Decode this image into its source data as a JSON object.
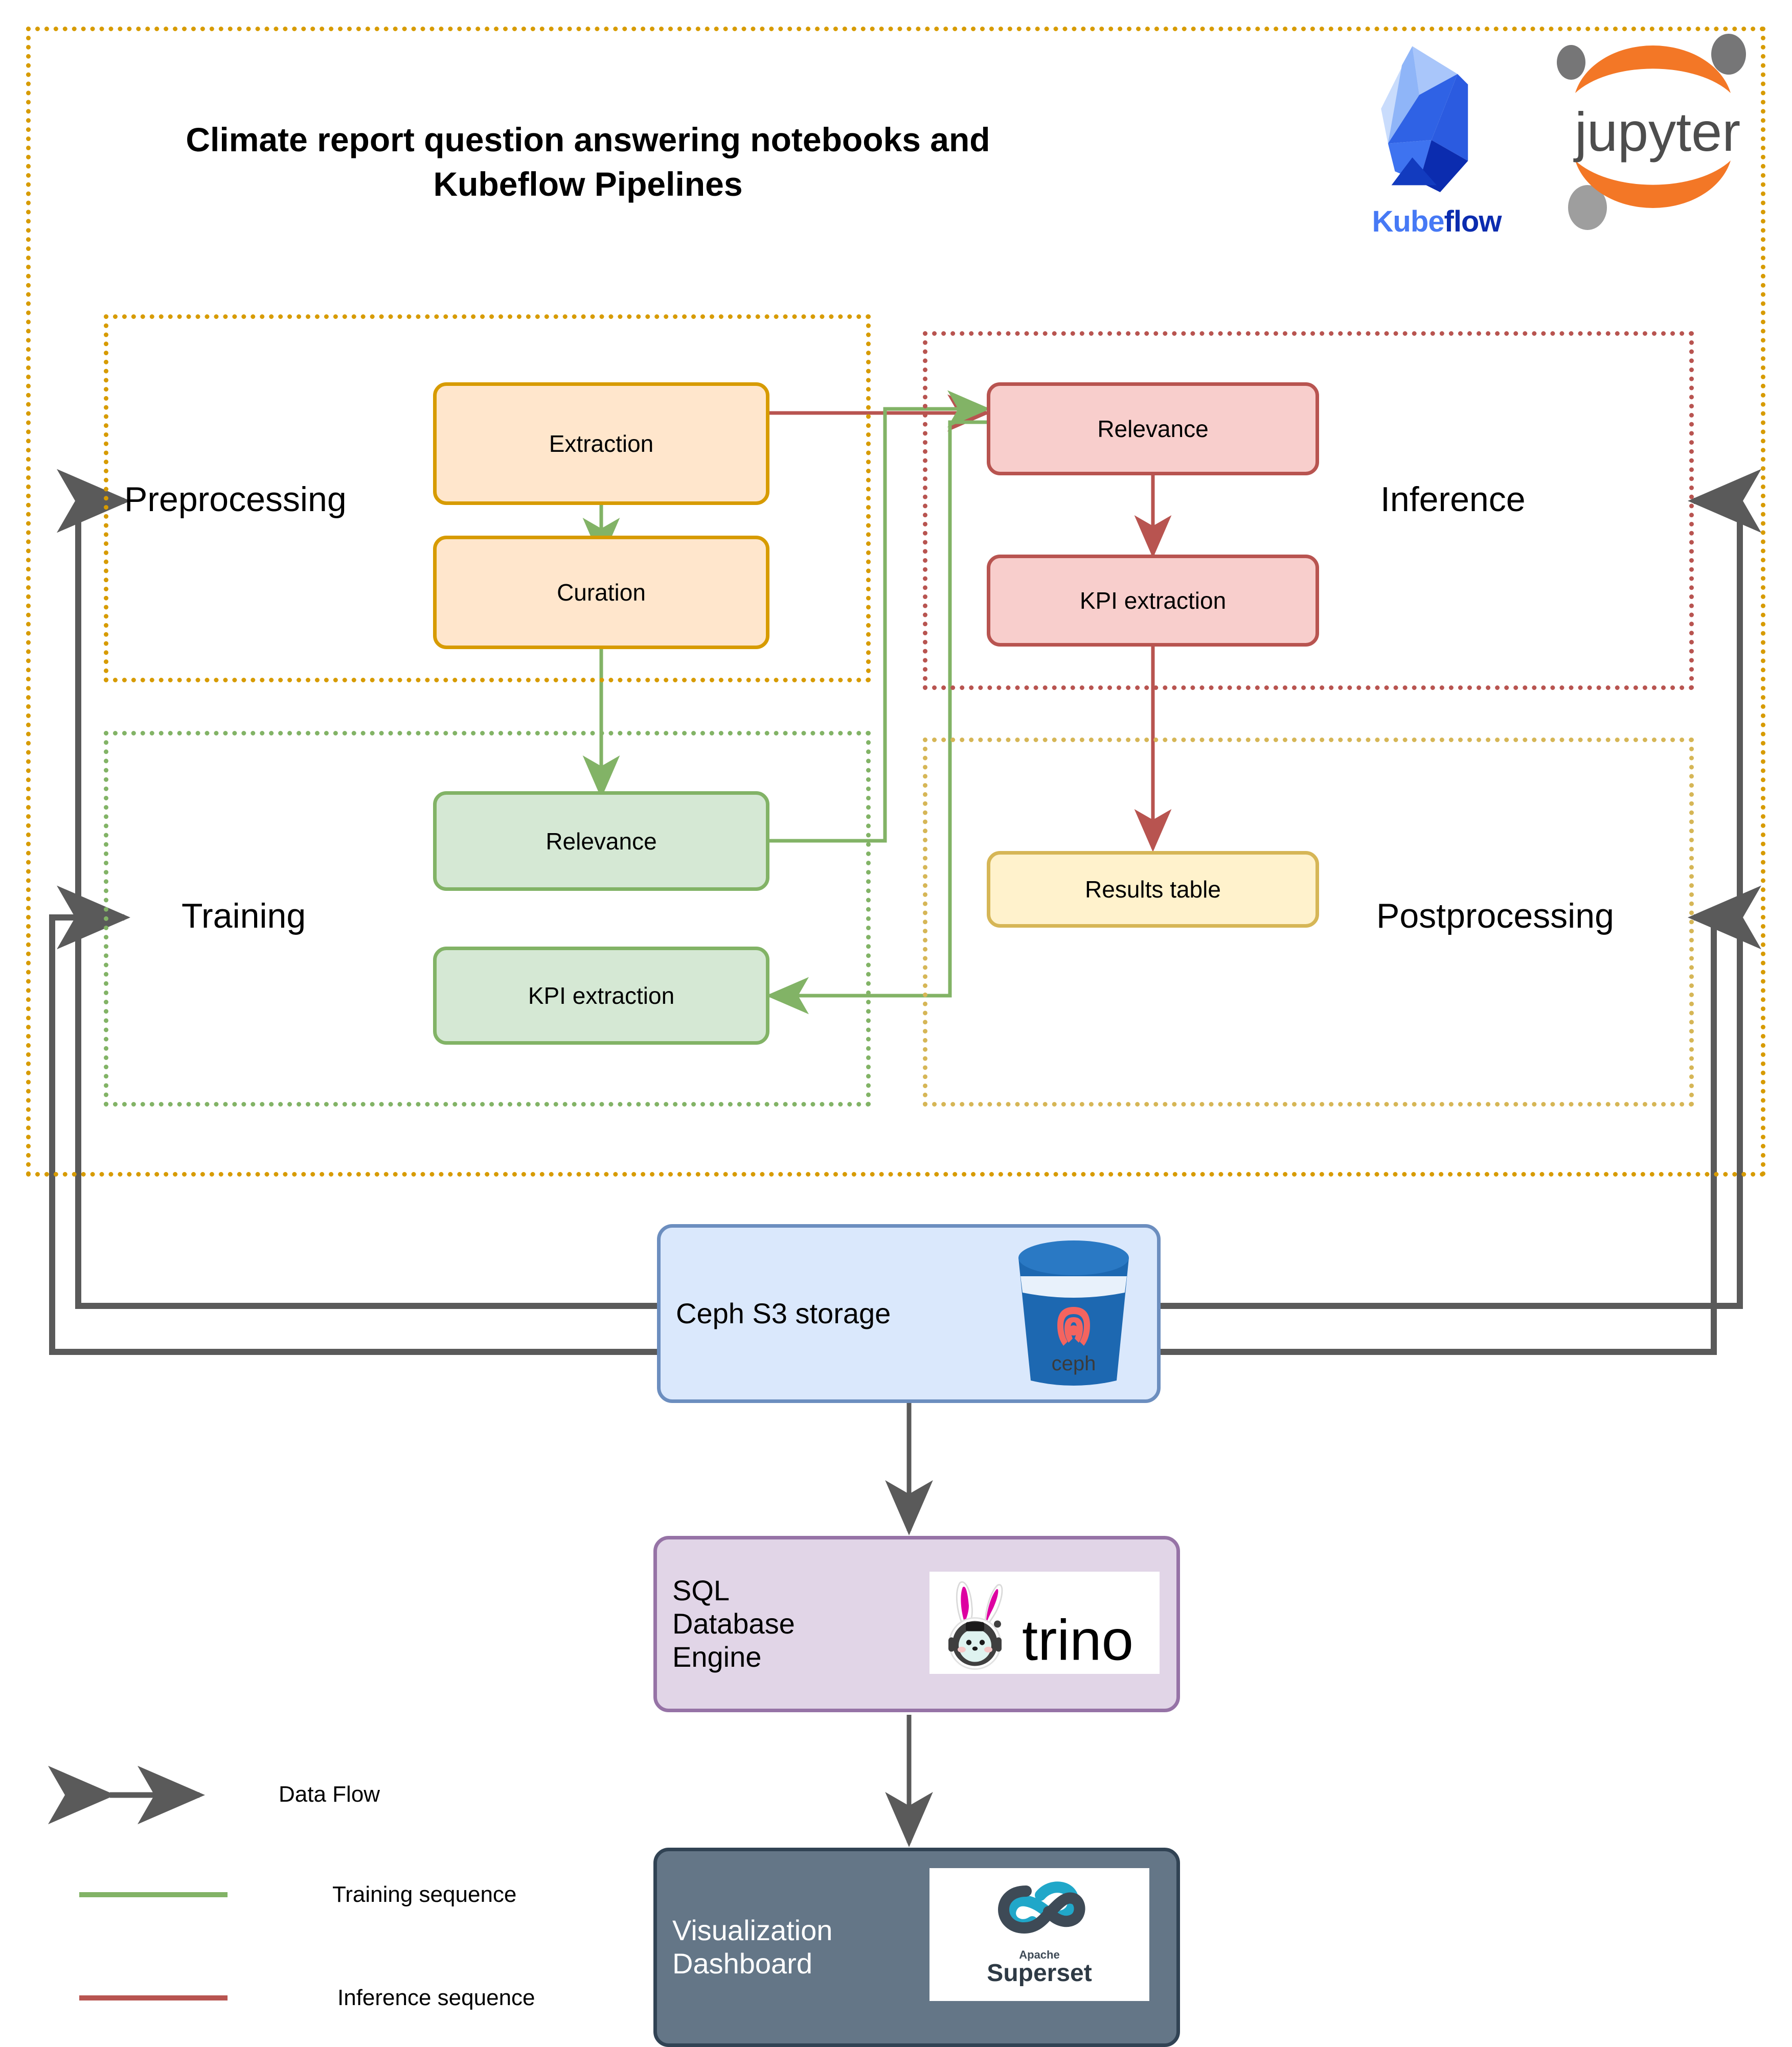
{
  "title": "Climate report question answering notebooks and\nKubeflow Pipelines",
  "logos": {
    "kubeflow": {
      "name": "kubeflow-logo",
      "wordmark_kube": "Kube",
      "wordmark_flow": "flow",
      "color_light": "#4679F5",
      "color_dark": "#0B2CAF"
    },
    "jupyter": {
      "name": "jupyter-logo",
      "wordmark": "jupyter",
      "color_orange": "#F37726",
      "color_gray": "#767677"
    },
    "ceph": {
      "name": "ceph-logo",
      "wordmark": "ceph",
      "color_blue": "#1D68B1",
      "color_red": "#F4645F"
    },
    "trino": {
      "name": "trino-logo",
      "wordmark": "trino",
      "color_pink": "#DD00A1"
    },
    "superset": {
      "name": "apache-superset-logo",
      "wordmark_top": "Apache",
      "wordmark_main": "Superset",
      "color_dark": "#3E4A56",
      "color_teal": "#20A7C9"
    }
  },
  "groups": {
    "outer": {
      "label": ""
    },
    "preprocessing": {
      "label": "Preprocessing",
      "color": "#D79B00"
    },
    "inference": {
      "label": "Inference",
      "color": "#B85450"
    },
    "training": {
      "label": "Training",
      "color": "#82B366"
    },
    "postprocessing": {
      "label": "Postprocessing",
      "color": "#D6B656"
    }
  },
  "nodes": {
    "extraction": {
      "label": "Extraction",
      "fill": "#FFE6CC",
      "stroke": "#D79B00"
    },
    "curation": {
      "label": "Curation",
      "fill": "#FFE6CC",
      "stroke": "#D79B00"
    },
    "inf_relevance": {
      "label": "Relevance",
      "fill": "#F8CECC",
      "stroke": "#B85450"
    },
    "inf_kpi": {
      "label": "KPI extraction",
      "fill": "#F8CECC",
      "stroke": "#B85450"
    },
    "train_relevance": {
      "label": "Relevance",
      "fill": "#D5E8D4",
      "stroke": "#82B366"
    },
    "train_kpi": {
      "label": "KPI extraction",
      "fill": "#D5E8D4",
      "stroke": "#82B366"
    },
    "results_table": {
      "label": "Results table",
      "fill": "#FFF2CC",
      "stroke": "#D6B656"
    }
  },
  "platforms": {
    "ceph": {
      "label": "Ceph S3 storage",
      "fill": "#DAE8FC",
      "stroke": "#6C8EBF"
    },
    "trino": {
      "label": "SQL\nDatabase\nEngine",
      "fill": "#E1D5E7",
      "stroke": "#9673A6"
    },
    "superset": {
      "label": "Visualization\nDashboard",
      "fill": "#647687",
      "stroke": "#314354"
    }
  },
  "legend": {
    "items": [
      {
        "label": "Data Flow",
        "style": "double-arrow",
        "color": "#5A5A5A"
      },
      {
        "label": "Training sequence",
        "style": "line",
        "color": "#82B366"
      },
      {
        "label": "Inference sequence",
        "style": "line",
        "color": "#B85450"
      }
    ]
  },
  "colors": {
    "data_flow": "#5A5A5A",
    "training": "#82B366",
    "inference": "#B85450",
    "orange": "#D79B00",
    "red": "#B85450",
    "green": "#82B366",
    "yellow": "#D6B656"
  }
}
